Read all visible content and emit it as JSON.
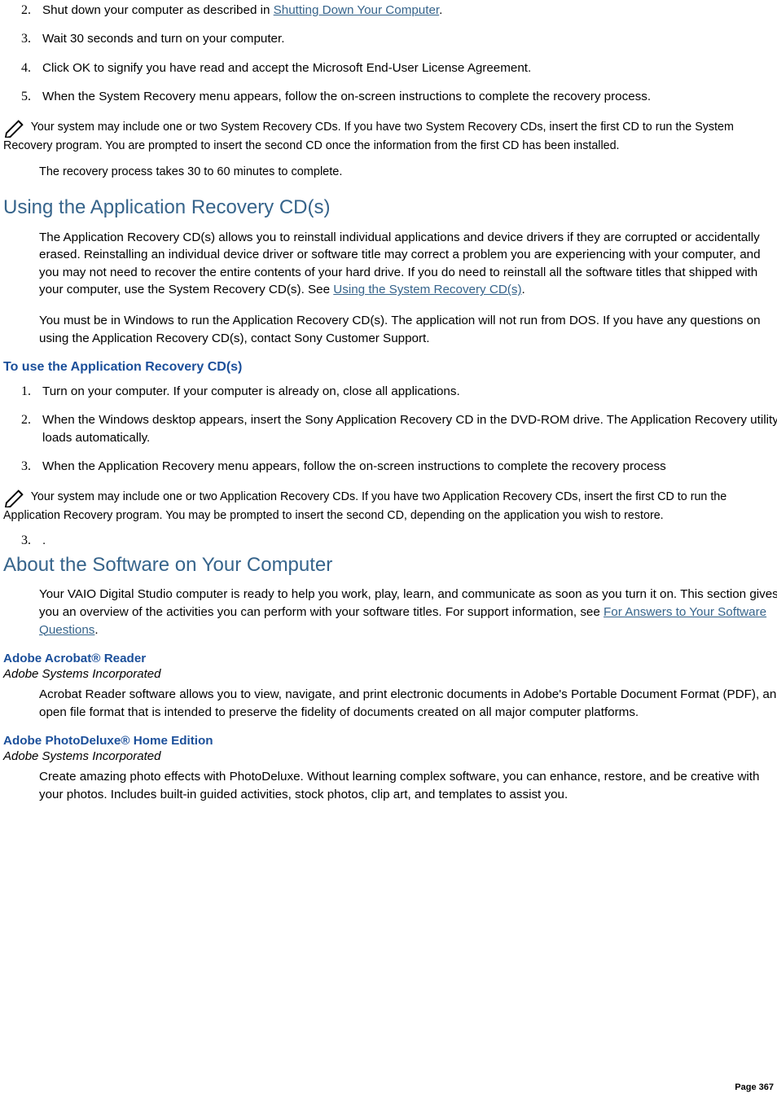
{
  "list1": {
    "items": [
      {
        "num": "2.",
        "pre": "Shut down your computer as described in ",
        "link": "Shutting Down Your Computer",
        "post": "."
      },
      {
        "num": "3.",
        "text": "Wait 30 seconds and turn on your computer."
      },
      {
        "num": "4.",
        "text": "Click OK to signify you have read and accept the Microsoft End-User License Agreement."
      },
      {
        "num": "5.",
        "text": "When the System Recovery menu appears, follow the on-screen instructions to complete the recovery process."
      }
    ]
  },
  "note1": " Your system may include one or two System Recovery CDs. If you have two System Recovery CDs, insert the first CD to run the System Recovery program. You are prompted to insert the second CD once the information from the first CD has been installed.",
  "indent1": "The recovery process takes 30 to 60 minutes to complete.",
  "heading1": "Using the Application Recovery CD(s)",
  "para1_pre": "The Application Recovery CD(s) allows you to reinstall individual applications and device drivers if they are corrupted or accidentally erased. Reinstalling an individual device driver or software title may correct a problem you are experiencing with your computer, and you may not need to recover the entire contents of your hard drive. If you do need to reinstall all the software titles that shipped with your computer, use the System Recovery CD(s). See ",
  "para1_link": "Using the System Recovery CD(s)",
  "para1_post": ".",
  "para2": "You must be in Windows to run the Application Recovery CD(s). The application will not run from DOS. If you have any questions on using the Application Recovery CD(s), contact Sony Customer Support.",
  "sub1": "To use the Application Recovery CD(s)",
  "list2": {
    "items": [
      {
        "num": "1.",
        "text": "Turn on your computer. If your computer is already on, close all applications."
      },
      {
        "num": "2.",
        "text": "When the Windows desktop appears, insert the Sony Application Recovery CD in the DVD-ROM drive. The Application Recovery utility loads automatically."
      },
      {
        "num": "3.",
        "text": "When the Application Recovery menu appears, follow the on-screen instructions to complete the recovery process"
      }
    ]
  },
  "note2": " Your system may include one or two Application Recovery CDs. If you have two Application Recovery CDs, insert the first CD to run the Application Recovery program. You may be prompted to insert the second CD, depending on the application you wish to restore.",
  "stray_num": "3.",
  "stray_dot": ".",
  "heading2": "About the Software on Your Computer",
  "para3_pre": "Your VAIO Digital Studio computer is ready to help you work, play, learn, and communicate as soon as you turn it on. This section gives you an overview of the activities you can perform with your software titles. For support information, see ",
  "para3_link": "For Answers to Your Software Questions",
  "para3_post": ".",
  "prog1_title": "Adobe Acrobat® Reader",
  "prog1_author": "Adobe Systems Incorporated",
  "prog1_body": "Acrobat Reader software allows you to view, navigate, and print electronic documents in Adobe's Portable Document Format (PDF), an open file format that is intended to preserve the fidelity of documents created on all major computer platforms.",
  "prog2_title": "Adobe PhotoDeluxe® Home Edition",
  "prog2_author": "Adobe Systems Incorporated",
  "prog2_body": "Create amazing photo effects with PhotoDeluxe. Without learning complex software, you can enhance, restore, and be creative with your photos. Includes built-in guided activities, stock photos, clip art, and templates to assist you.",
  "page_number": "Page 367"
}
